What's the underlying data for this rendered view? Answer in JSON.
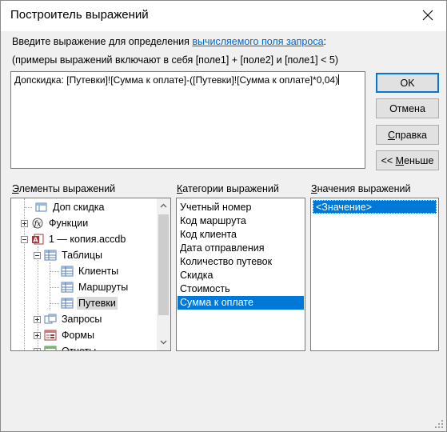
{
  "window": {
    "title": "Построитель выражений"
  },
  "description": {
    "line1_prefix": "Введите выражение для определения ",
    "line1_link": "вычисляемого поля запроса",
    "line1_suffix": ":",
    "line2": "(примеры выражений включают в себя [поле1] + [поле2] и [поле1] < 5)"
  },
  "expression": {
    "value": "Допскидка: [Путевки]![Сумма к оплате]-([Путевки]![Сумма к оплате]*0,04)"
  },
  "buttons": {
    "ok": "OK",
    "cancel": "Отмена",
    "help_underlined": "С",
    "help_rest": "правка",
    "less_prefix": "<< ",
    "less_underlined": "М",
    "less_rest": "еньше"
  },
  "sections": {
    "elements_underlined": "Э",
    "elements_rest": "лементы выражений",
    "categories_underlined": "К",
    "categories_rest": "атегории выражений",
    "values_underlined": "З",
    "values_rest": "начения выражений"
  },
  "tree": {
    "items": [
      {
        "label": "Доп скидка",
        "icon": "query-field-icon",
        "expander": "none"
      },
      {
        "label": "Функции",
        "icon": "function-icon",
        "expander": "plus"
      },
      {
        "label": "1 — копия.accdb",
        "icon": "access-db-icon",
        "expander": "minus"
      },
      {
        "label": "Таблицы",
        "icon": "table-icon",
        "expander": "minus"
      },
      {
        "label": "Клиенты",
        "icon": "table-icon",
        "expander": "none"
      },
      {
        "label": "Маршруты",
        "icon": "table-icon",
        "expander": "none"
      },
      {
        "label": "Путевки",
        "icon": "table-icon",
        "expander": "none",
        "selected": true
      },
      {
        "label": "Запросы",
        "icon": "query-icon",
        "expander": "plus"
      },
      {
        "label": "Формы",
        "icon": "form-icon",
        "expander": "plus"
      },
      {
        "label": "Отчеты",
        "icon": "report-icon",
        "expander": "plus"
      }
    ]
  },
  "categories": {
    "items": [
      "Учетный номер",
      "Код маршрута",
      "Код клиента",
      "Дата отправления",
      "Количество путевок",
      "Скидка",
      "Стоимость",
      "Сумма к оплате"
    ],
    "selected_index": 7
  },
  "values": {
    "items": [
      "<Значение>"
    ],
    "selected_index": 0
  },
  "colors": {
    "accent": "#0078d7",
    "link": "#0066cc",
    "background": "#f0f0f0"
  }
}
